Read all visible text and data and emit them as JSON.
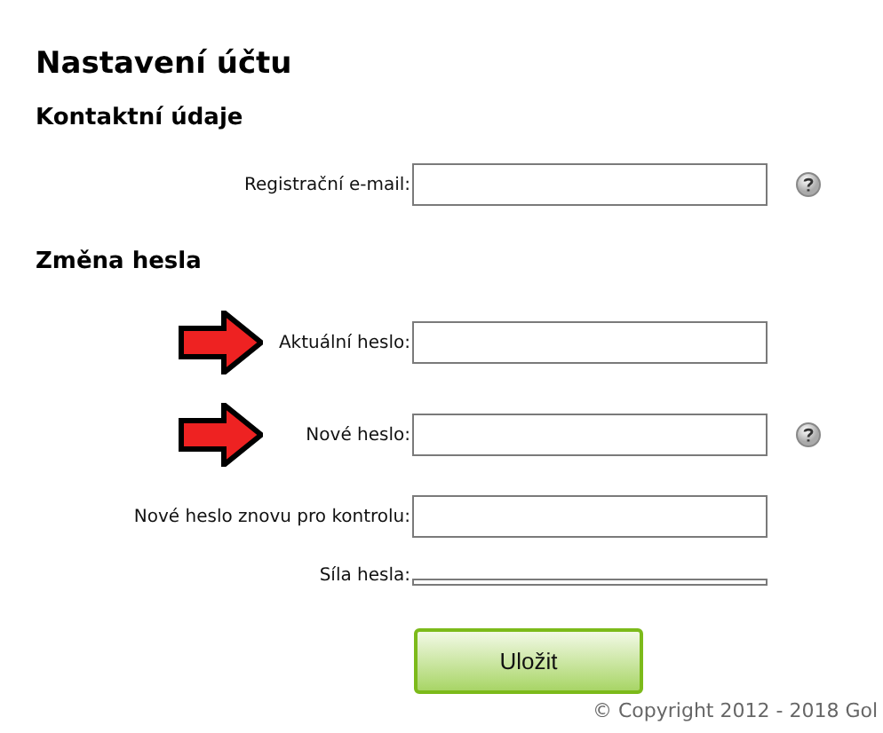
{
  "title": "Nastavení účtu",
  "sections": [
    {
      "heading": "Kontaktní údaje",
      "fields": [
        {
          "kind": "input",
          "label": "Registrační e-mail:",
          "help": true,
          "arrow": false
        }
      ]
    },
    {
      "heading": "Změna hesla",
      "fields": [
        {
          "kind": "input",
          "label": "Aktuální heslo:",
          "help": false,
          "arrow": true
        },
        {
          "kind": "input",
          "label": "Nové heslo:",
          "help": true,
          "arrow": true
        },
        {
          "kind": "input",
          "label": "Nové heslo znovu pro kontrolu:",
          "help": false,
          "arrow": false
        },
        {
          "kind": "meter",
          "label": "Síla hesla:",
          "help": false,
          "arrow": false
        }
      ]
    }
  ],
  "save_button": "Uložit",
  "footer": "© Copyright 2012 - 2018 Gol"
}
